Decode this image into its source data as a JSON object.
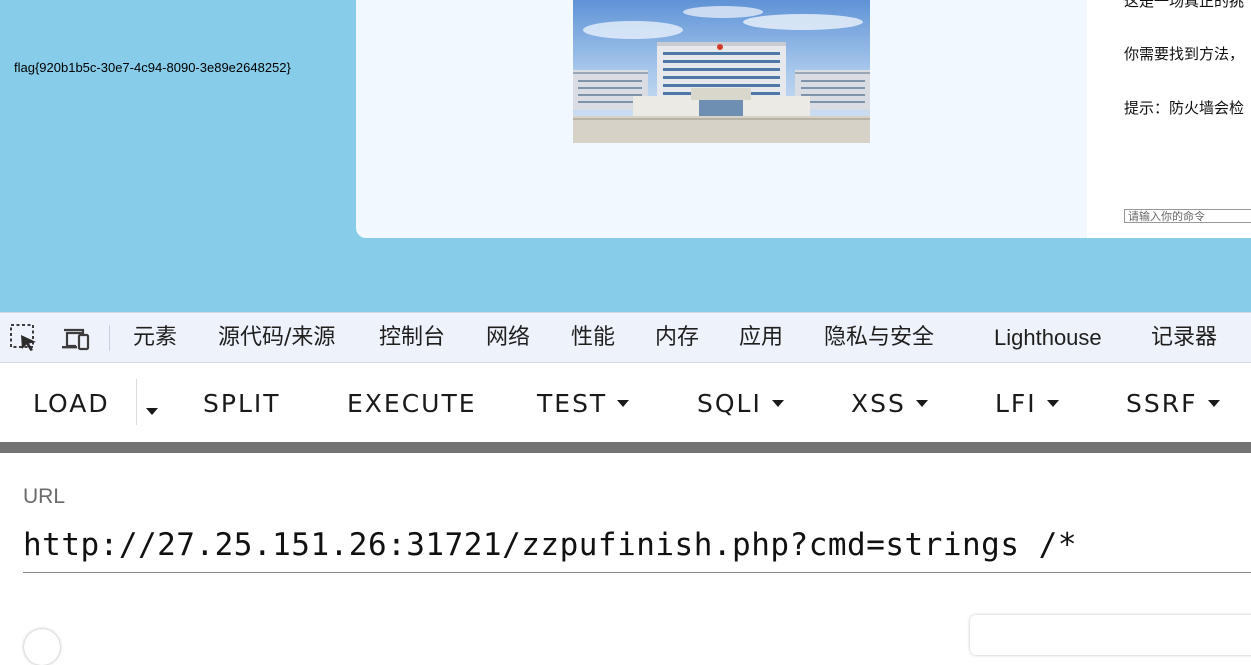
{
  "page": {
    "flag": "flag{920b1b5c-30e7-4c94-8090-3e89e2648252}",
    "card_lines": [
      "这是一场真正的挑",
      "你需要找到方法，",
      "提示：防火墙会检"
    ],
    "command_placeholder": "请输入你的命令"
  },
  "devtools": {
    "icons": [
      "inspect-element-icon",
      "device-toolbar-icon"
    ],
    "tabs": [
      "元素",
      "源代码/来源",
      "控制台",
      "网络",
      "性能",
      "内存",
      "应用",
      "隐私与安全",
      "Lighthouse",
      "记录器"
    ]
  },
  "hackbar": {
    "buttons": [
      "LOAD",
      "SPLIT",
      "EXECUTE",
      "TEST",
      "SQLI",
      "XSS",
      "LFI",
      "SSRF"
    ]
  },
  "url_section": {
    "label": "URL",
    "value": "http://27.25.151.26:31721/zzpufinish.php?cmd=strings /*"
  },
  "colors": {
    "page_background": "#87cdea",
    "card_background": "#f2f8ff",
    "devtools_bar": "#eef2fb",
    "hackbar_band": "#737373"
  }
}
